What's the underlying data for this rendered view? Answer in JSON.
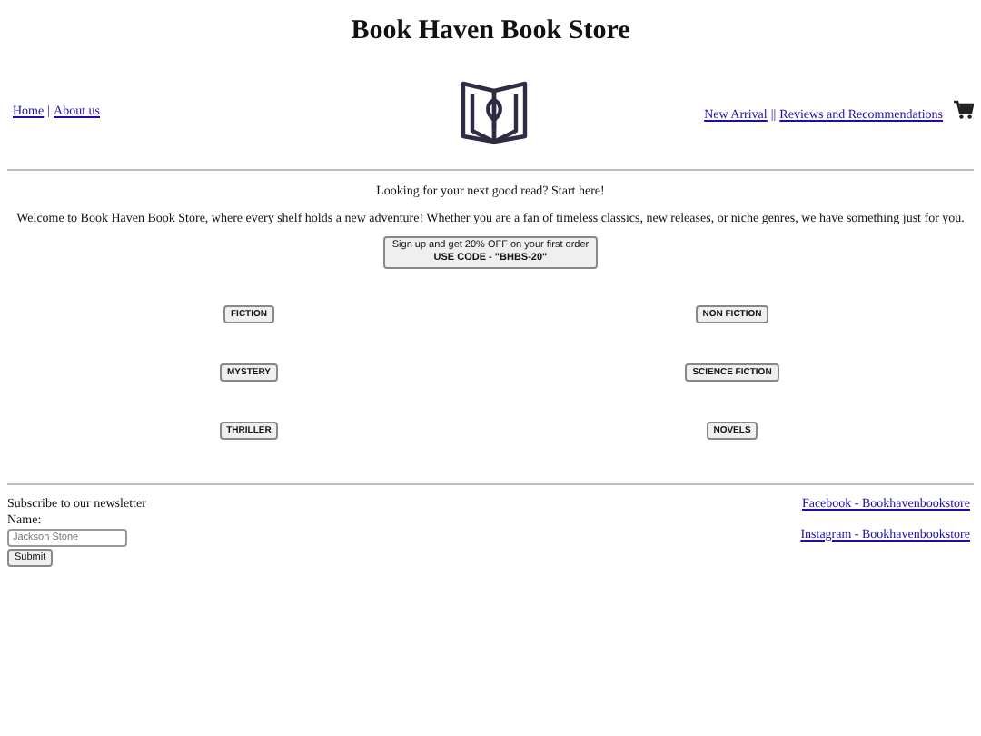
{
  "title": "Book Haven Book Store",
  "nav_left": {
    "links": [
      "Home",
      "About us"
    ],
    "separator": "|"
  },
  "nav_right": {
    "links": [
      "New Arrival",
      "Reviews and Recommendations"
    ],
    "separator": "||"
  },
  "tagline": "Looking for your next good read? Start here!",
  "welcome": "Welcome to Book Haven Book Store, where every shelf holds a new adventure! Whether you are a fan of timeless classics, new releases, or niche genres, we have something just for you.",
  "promo": {
    "line1": "Sign up and get 20% OFF on your first order",
    "line2": "USE CODE - \"BHBS-20\""
  },
  "genres": [
    "FICTION",
    "NON FICTION",
    "MYSTERY",
    "SCIENCE FICTION",
    "THRILLER",
    "NOVELS"
  ],
  "newsletter": {
    "heading": "Subscribe to our newsletter",
    "label": "Name:",
    "placeholder": "Jackson Stone",
    "button": "Submit"
  },
  "social": [
    "Facebook - Bookhavenbookstore",
    "Instagram - Bookhavenbookstore"
  ]
}
